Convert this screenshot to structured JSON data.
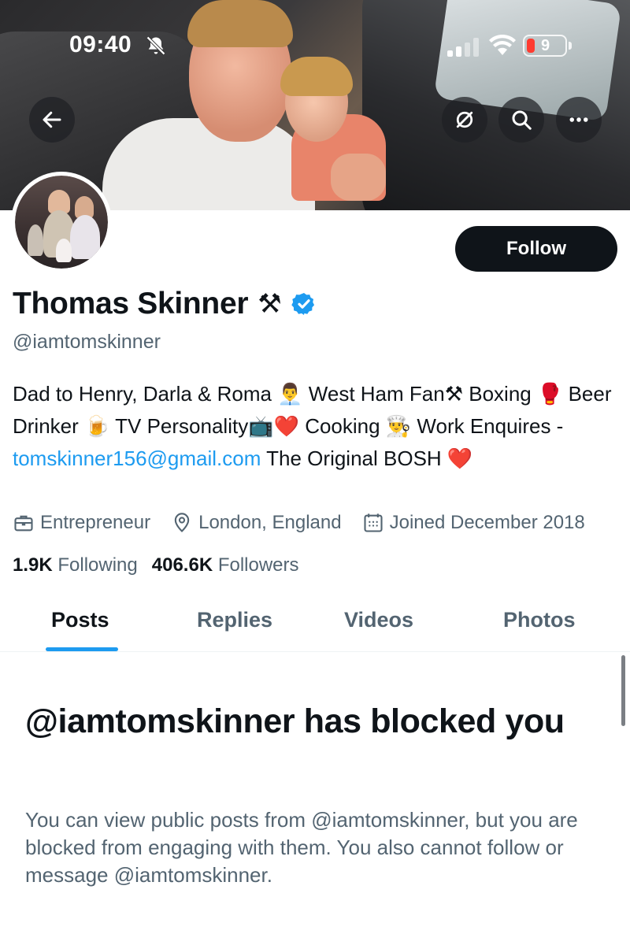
{
  "status_bar": {
    "time": "09:40",
    "battery": "9",
    "icons": [
      "bell-slash-icon",
      "signal-icon",
      "wifi-icon",
      "battery-icon"
    ]
  },
  "header": {
    "buttons": [
      "back-arrow-icon",
      "hide-icon",
      "search-icon",
      "more-icon"
    ]
  },
  "profile": {
    "display_name": "Thomas Skinner",
    "name_emoji": "⚒",
    "handle": "@iamtomskinner",
    "follow_label": "Follow",
    "verified_color": "#1d9bf0"
  },
  "bio": {
    "part1": "Dad to Henry, Darla & Roma ",
    "emoji1": "👨‍💼",
    "part2": " West Ham Fan",
    "emoji2": "⚒",
    "part3": " Boxing ",
    "emoji3": "🥊",
    "part4": " Beer Drinker ",
    "emoji4": "🍺",
    "part5": " TV Personality",
    "emoji5": "📺",
    "emoji6": "❤️",
    "part6": " Cooking ",
    "emoji7": "👨‍🍳",
    "part7": " Work Enquires - ",
    "link": "tomskinner156@gmail.com",
    "part8": " The Original BOSH ",
    "emoji8": "❤️"
  },
  "meta": {
    "occupation": "Entrepreneur",
    "location": "London, England",
    "joined": "Joined December 2018"
  },
  "stats": {
    "following_count": "1.9K",
    "following_label": "Following",
    "followers_count": "406.6K",
    "followers_label": "Followers"
  },
  "tabs": [
    {
      "label": "Posts",
      "active": true
    },
    {
      "label": "Replies",
      "active": false
    },
    {
      "label": "Videos",
      "active": false
    },
    {
      "label": "Photos",
      "active": false
    }
  ],
  "blocked": {
    "title": "@iamtomskinner has blocked you",
    "body": "You can view public posts from @iamtomskinner, but you are blocked from engaging with them. You also cannot follow or message @iamtomskinner."
  },
  "colors": {
    "accent": "#1d9bf0",
    "text_primary": "#0f1419",
    "text_secondary": "#536471"
  }
}
